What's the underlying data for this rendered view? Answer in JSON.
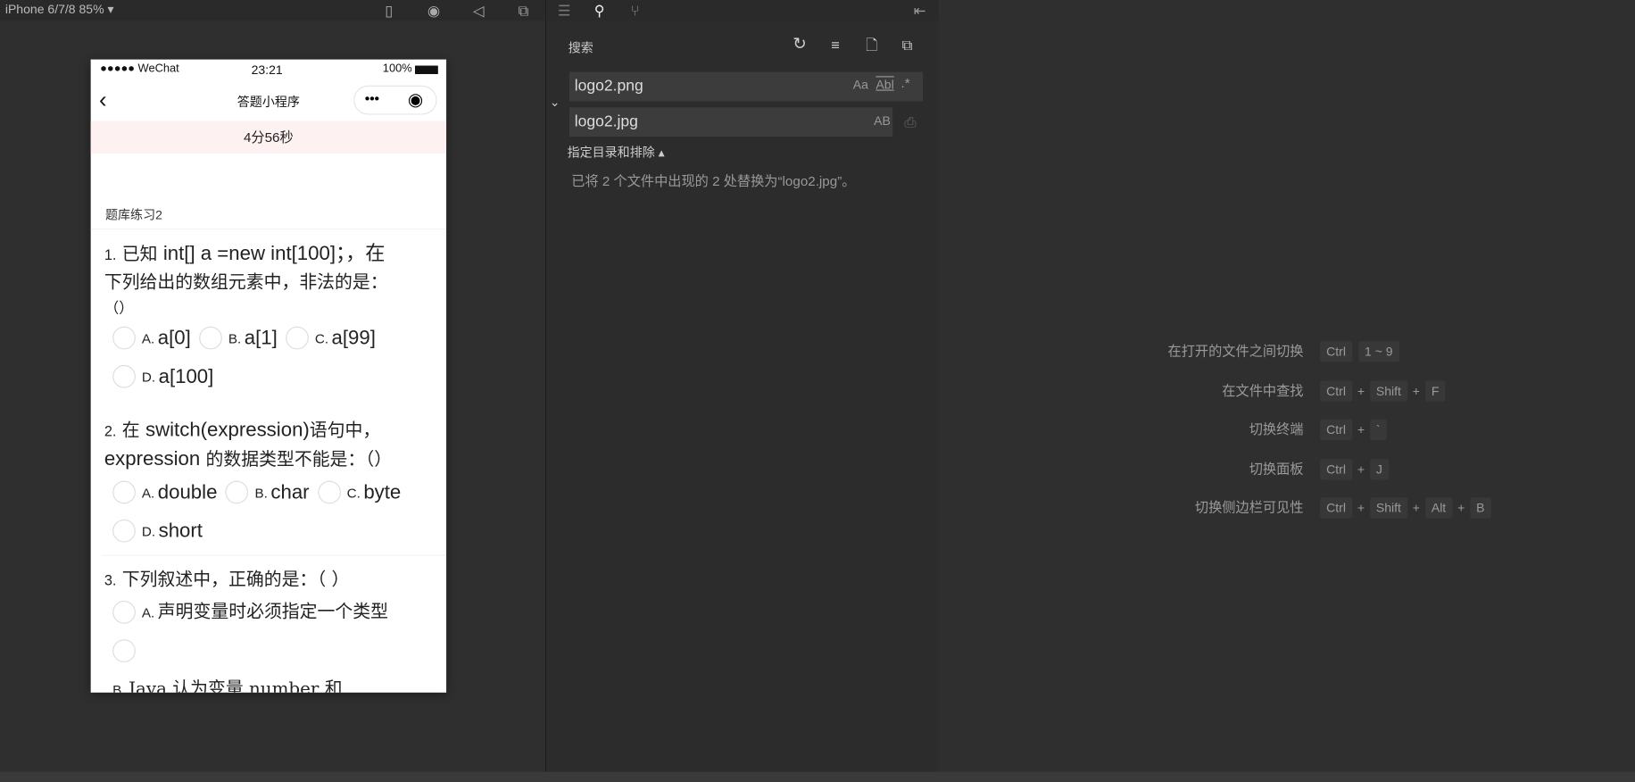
{
  "simulator": {
    "device": "iPhone 6/7/8 85%",
    "toolbar_icons": [
      "phone-icon",
      "record-icon",
      "sound-icon",
      "window-icon"
    ],
    "phone": {
      "status": {
        "carrier": "●●●●● WeChat",
        "time": "23:21",
        "battery": "100%"
      },
      "nav": {
        "title": "答题小程序",
        "menu": "•••"
      },
      "timer": "4分56秒",
      "section_title": "题库练习2",
      "questions": [
        {
          "num": "1.",
          "text_a": "已知",
          "code": "int[] a =new int[100]；，在",
          "text_b": "下列给出的数组元素中，非法的是：",
          "text_c": "（）",
          "options": [
            {
              "label": "A.",
              "value": "a[0]"
            },
            {
              "label": "B.",
              "value": "a[1]"
            },
            {
              "label": "C.",
              "value": "a[99]"
            },
            {
              "label": "D.",
              "value": "a[100]"
            }
          ]
        },
        {
          "num": "2.",
          "text_a": "在",
          "code": "switch(expression)",
          "text_b": "语句中，",
          "line2_code": "expression",
          "line2_text": "的数据类型不能是：（）",
          "options": [
            {
              "label": "A.",
              "value": "double"
            },
            {
              "label": "B.",
              "value": "char"
            },
            {
              "label": "C.",
              "value": "byte"
            },
            {
              "label": "D.",
              "value": "short"
            }
          ]
        },
        {
          "num": "3.",
          "text": "下列叙述中，正确的是：（ ）",
          "options": [
            {
              "label": "A.",
              "value": "声明变量时必须指定一个类型"
            },
            {
              "label": "B.",
              "value": "Java 认为变量  number 和"
            }
          ]
        }
      ]
    }
  },
  "search_panel": {
    "title": "搜索",
    "search_value": "logo2.png",
    "replace_value": "logo2.jpg",
    "search_opts": [
      "Aa",
      "Abl",
      ".*"
    ],
    "replace_opt": "AB",
    "include_exclude": "指定目录和排除 ▴",
    "result_message": "已将 2 个文件中出现的 2 处替换为“logo2.jpg”。"
  },
  "shortcuts": [
    {
      "label": "在打开的文件之间切换",
      "keys": [
        "Ctrl",
        "1 ~ 9"
      ],
      "joined": false
    },
    {
      "label": "在文件中查找",
      "keys": [
        "Ctrl",
        "Shift",
        "F"
      ],
      "joined": true
    },
    {
      "label": "切换终端",
      "keys": [
        "Ctrl",
        "`"
      ],
      "joined": true
    },
    {
      "label": "切换面板",
      "keys": [
        "Ctrl",
        "J"
      ],
      "joined": true
    },
    {
      "label": "切换侧边栏可见性",
      "keys": [
        "Ctrl",
        "Shift",
        "Alt",
        "B"
      ],
      "joined": true
    }
  ]
}
